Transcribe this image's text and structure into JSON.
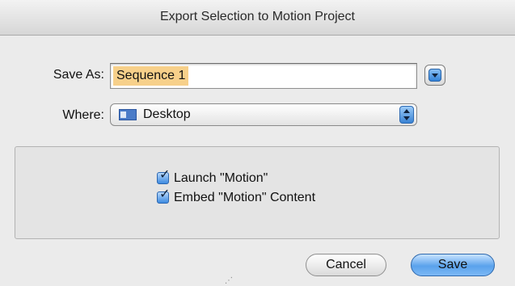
{
  "window": {
    "title": "Export Selection to Motion Project"
  },
  "save_as": {
    "label": "Save As:",
    "value": "Sequence 1"
  },
  "where": {
    "label": "Where:",
    "selected": "Desktop"
  },
  "options": [
    {
      "label": "Launch \"Motion\"",
      "checked": true
    },
    {
      "label": "Embed \"Motion\" Content",
      "checked": true
    }
  ],
  "buttons": {
    "cancel": "Cancel",
    "save": "Save"
  },
  "icons": {
    "check": "✓",
    "disclosure": "chevron-down-icon",
    "folder": "desktop-folder-icon"
  },
  "colors": {
    "selection_highlight": "#f7d08a",
    "accent_blue": "#3d8ae0",
    "window_bg": "#ebebeb"
  }
}
